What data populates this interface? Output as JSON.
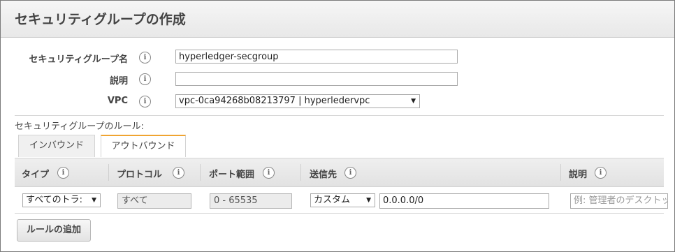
{
  "header": {
    "title": "セキュリティグループの作成"
  },
  "form": {
    "name_label": "セキュリティグループ名",
    "name_value": "hyperledger-secgroup",
    "description_label": "説明",
    "description_value": "",
    "vpc_label": "VPC",
    "vpc_value": "vpc-0ca94268b08213797 | hyperledervpc"
  },
  "info_glyph": "i",
  "rules": {
    "caption": "セキュリティグループのルール:",
    "tabs": [
      {
        "label": "インバウンド",
        "active": false
      },
      {
        "label": "アウトバウンド",
        "active": true
      }
    ],
    "columns": [
      "タイプ",
      "プロトコル",
      "ポート範囲",
      "送信先",
      "説明"
    ],
    "row": {
      "type": "すべてのトラ:",
      "protocol": "すべて",
      "port_range": "0 - 65535",
      "destination_type": "カスタム",
      "destination_value": "0.0.0.0/0",
      "description_placeholder": "例: 管理者のデスクトップ"
    }
  },
  "buttons": {
    "add_rule": "ルールの追加"
  },
  "colors": {
    "active_tab_accent": "#f0a431",
    "header_bg": "#eeeeee"
  },
  "icons": {
    "info": "info-circle-icon",
    "dropdown": "caret-down-icon"
  }
}
